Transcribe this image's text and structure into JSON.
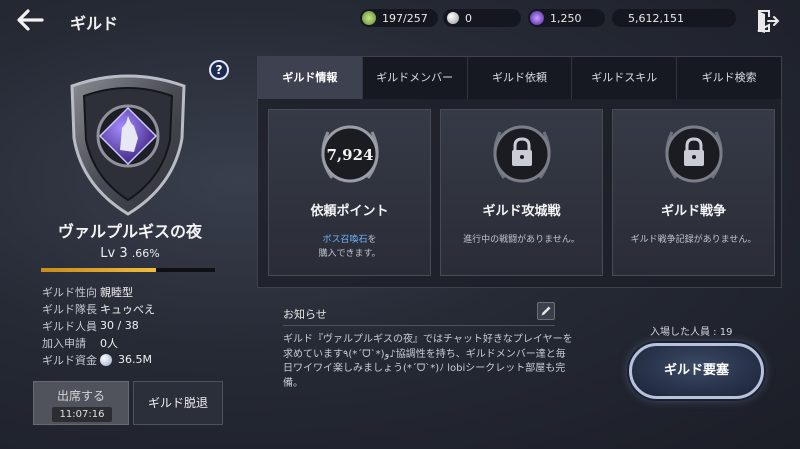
{
  "header": {
    "title": "ギルド",
    "back_icon": "back-arrow-icon",
    "exit_icon": "exit-door-icon"
  },
  "resources": [
    {
      "icon": "stamina-icon",
      "color": "#8bc34a",
      "value": "197/257"
    },
    {
      "icon": "pearl-icon",
      "color": "#d8d8d8",
      "value": "0"
    },
    {
      "icon": "purple-gem-icon",
      "color": "#7b3fd6",
      "value": "1,250"
    },
    {
      "icon": "gold-icon",
      "color": "#d4a93a",
      "value": "5,612,151"
    }
  ],
  "guild": {
    "name": "ヴァルプルギスの夜",
    "level_label": "Lv 3",
    "level_pct": ".66%",
    "xp_fraction": 0.66,
    "stats": [
      {
        "label": "ギルド性向",
        "value": "親睦型"
      },
      {
        "label": "ギルド隊長",
        "value": "キュゥべえ"
      },
      {
        "label": "ギルド人員",
        "value": "30 / 38"
      },
      {
        "label": "加入申請",
        "value": "0人"
      },
      {
        "label": "ギルド資金",
        "value": "36.5M"
      }
    ]
  },
  "buttons": {
    "help": "?",
    "attend": "出席する",
    "attend_timer": "11:07:16",
    "leave": "ギルド脱退",
    "fortress": "ギルド要塞"
  },
  "tabs": [
    "ギルド情報",
    "ギルドメンバー",
    "ギルド依頼",
    "ギルドスキル",
    "ギルド検索"
  ],
  "cards": [
    {
      "medal": "7,924",
      "title": "依頼ポイント",
      "desc_highlight": "ボス召喚石",
      "desc_after": "を",
      "desc_line2": "購入できます。"
    },
    {
      "medal": "lock-icon",
      "title": "ギルド攻城戦",
      "desc": "進行中の戦闘がありません。"
    },
    {
      "medal": "lock-icon",
      "title": "ギルド戦争",
      "desc": "ギルド戦争記録がありません。"
    }
  ],
  "notice": {
    "title": "お知らせ",
    "body": "ギルド『ヴァルプルギスの夜』ではチャット好きなプレイヤーを求めています٩(*ˊᗜˋ*)و♪協調性を持ち、ギルドメンバー達と毎日ワイワイ楽しみましょう(*ˊᗜˋ*)ﾉ lobiシークレット部屋も完備。"
  },
  "entered": "入場した人員 : 19",
  "colors": {
    "accent_gold": "#f2bd3a",
    "highlight_blue": "#6fb5ff",
    "active_tab": "#3e4250"
  }
}
